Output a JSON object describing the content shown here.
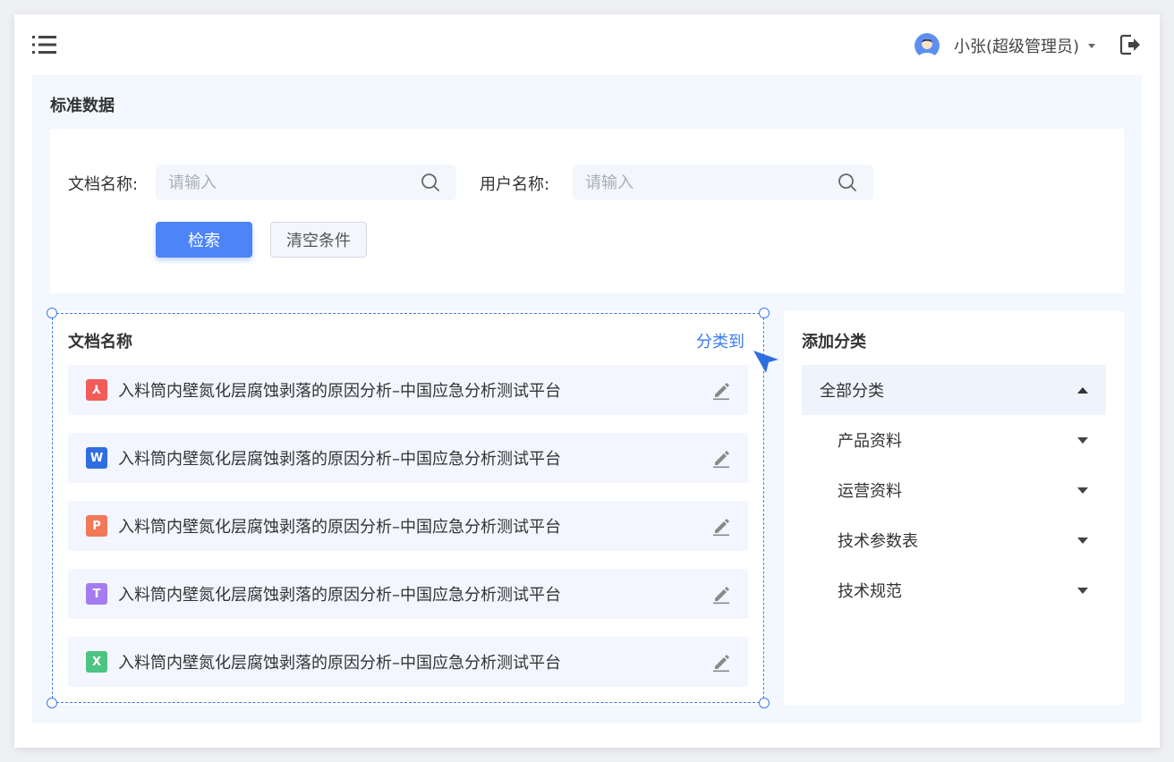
{
  "header": {
    "user_name": "小张(超级管理员)"
  },
  "page": {
    "title": "标准数据"
  },
  "filters": {
    "doc_name_label": "文档名称:",
    "doc_name_placeholder": "请输入",
    "user_name_label": "用户名称:",
    "user_name_placeholder": "请输入",
    "search_button": "检索",
    "clear_button": "清空条件"
  },
  "doc_list": {
    "title": "文档名称",
    "classify_link": "分类到",
    "items": [
      {
        "name": "入料筒内壁氮化层腐蚀剥落的原因分析–中国应急分析测试平台",
        "type": "pdf-icon",
        "glyph": "⅄",
        "color": "#f15b58"
      },
      {
        "name": "入料筒内壁氮化层腐蚀剥落的原因分析–中国应急分析测试平台",
        "type": "word-icon",
        "glyph": "W",
        "color": "#2f6ee0"
      },
      {
        "name": "入料筒内壁氮化层腐蚀剥落的原因分析–中国应急分析测试平台",
        "type": "ppt-icon",
        "glyph": "P",
        "color": "#f27858"
      },
      {
        "name": "入料筒内壁氮化层腐蚀剥落的原因分析–中国应急分析测试平台",
        "type": "text-icon",
        "glyph": "T",
        "color": "#a57cf0"
      },
      {
        "name": "入料筒内壁氮化层腐蚀剥落的原因分析–中国应急分析测试平台",
        "type": "excel-icon",
        "glyph": "X",
        "color": "#4dc384"
      }
    ]
  },
  "categories": {
    "title": "添加分类",
    "root": "全部分类",
    "items": [
      "产品资料",
      "运营资料",
      "技术参数表",
      "技术规范"
    ]
  },
  "colors": {
    "accent": "#3a7af2",
    "primary_button": "#4d84f7",
    "panel_bg": "#f3f7fe"
  }
}
